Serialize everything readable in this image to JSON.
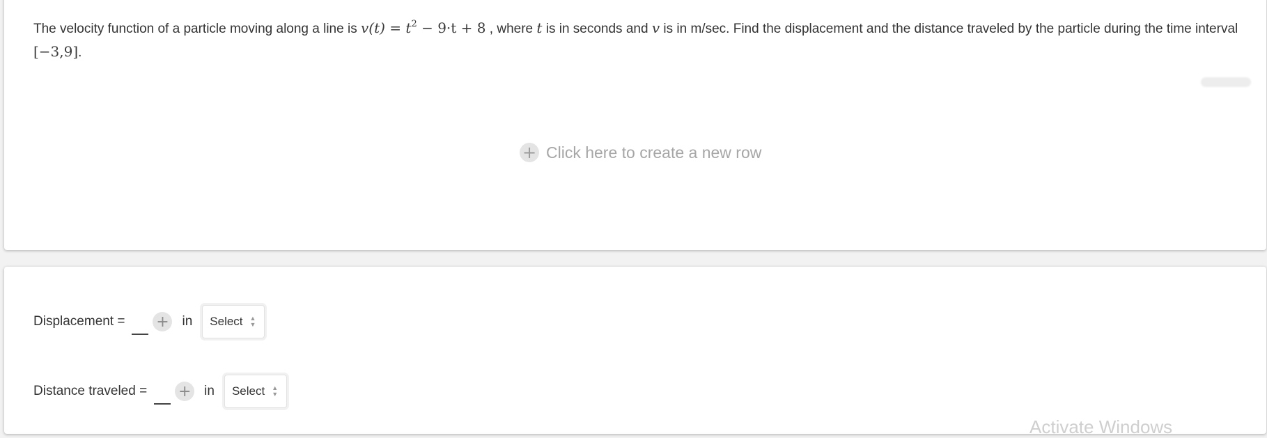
{
  "question": {
    "prefix": "The velocity function of a particle moving along a line is",
    "math_v_of_t": "v(t) = t",
    "math_exp": "2",
    "math_rest": " − 9·t + 8",
    "mid1": ", where",
    "var_t": "t",
    "mid2": "is in seconds and",
    "var_v": "v",
    "suffix": "is in m/sec. Find the displacement and the distance traveled by the particle during the time interval",
    "interval": "[−3,9]",
    "end": "."
  },
  "new_row": {
    "icon": "plus-icon",
    "plus": "+",
    "label": "Click here to create a new row"
  },
  "answers": {
    "displacement_label": "Displacement =",
    "distance_label": "Distance traveled =",
    "plus": "+",
    "in_label": "in",
    "select_value": "Select",
    "arrow_up": "▲",
    "arrow_down": "▼"
  },
  "watermark": {
    "text": "Activate Windows"
  }
}
